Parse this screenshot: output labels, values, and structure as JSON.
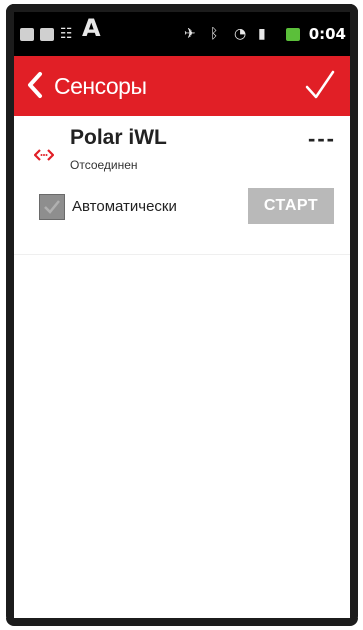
{
  "statusbar": {
    "time": "0:04",
    "icons": [
      "checkbox-icon",
      "play-icon",
      "list-icon",
      "font-a-icon",
      "satellite-icon",
      "bluetooth-icon",
      "wifi-icon",
      "signal-icon",
      "battery-icon"
    ]
  },
  "actionbar": {
    "title": "Сенсоры",
    "back_icon": "chevron-left-icon",
    "confirm_icon": "checkmark-icon",
    "color": "#e11f26"
  },
  "sensor": {
    "name": "Polar iWL",
    "status": "Отсоединен",
    "value": "---",
    "auto_label": "Автоматически",
    "auto_checked": true,
    "start_label": "СТАРТ"
  }
}
